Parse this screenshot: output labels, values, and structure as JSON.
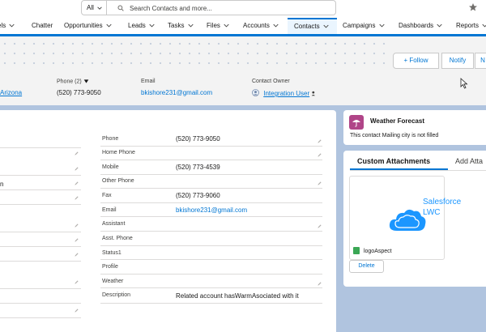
{
  "search": {
    "scope_label": "All",
    "placeholder": "Search Contacts and more..."
  },
  "nav": {
    "items": [
      {
        "label": "els",
        "active": false
      },
      {
        "label": "Chatter",
        "active": false
      },
      {
        "label": "Opportunities",
        "active": false
      },
      {
        "label": "Leads",
        "active": false
      },
      {
        "label": "Tasks",
        "active": false
      },
      {
        "label": "Files",
        "active": false
      },
      {
        "label": "Accounts",
        "active": false
      },
      {
        "label": "Contacts",
        "active": true
      },
      {
        "label": "Campaigns",
        "active": false
      },
      {
        "label": "Dashboards",
        "active": false
      },
      {
        "label": "Reports",
        "active": false
      }
    ]
  },
  "header": {
    "follow_label": "Follow",
    "notify_label": "Notify",
    "more_label": "N",
    "highlights": {
      "account_value": "Arizona",
      "phone_label": "Phone (2)",
      "phone_value": "(520) 773-9050",
      "email_label": "Email",
      "email_value": "bkishore231@gmail.com",
      "owner_label": "Contact Owner",
      "owner_value": "Integration User"
    }
  },
  "details": {
    "left_fragment": "n",
    "fields": [
      {
        "label": "Phone",
        "value": "(520) 773-9050",
        "link": false
      },
      {
        "label": "Home Phone",
        "value": "",
        "link": false
      },
      {
        "label": "Mobile",
        "value": "(520) 773-4539",
        "link": false
      },
      {
        "label": "Other Phone",
        "value": "",
        "link": false
      },
      {
        "label": "Fax",
        "value": "(520) 773-9060",
        "link": false
      },
      {
        "label": "Email",
        "value": "bkishore231@gmail.com",
        "link": true
      },
      {
        "label": "Assistant",
        "value": "",
        "link": false
      },
      {
        "label": "Asst. Phone",
        "value": "",
        "link": false
      },
      {
        "label": "Status1",
        "value": "",
        "link": false
      },
      {
        "label": "Profile",
        "value": "",
        "link": false
      },
      {
        "label": "Weather",
        "value": "",
        "link": false
      },
      {
        "label": "Description",
        "value": "Related account hasWarmAsociated with it",
        "link": false
      }
    ]
  },
  "weather": {
    "title": "Weather Forecast",
    "message": "This contact Mailing city is not filled"
  },
  "attachments": {
    "tab_active": "Custom Attachments",
    "tab_other": "Add Atta",
    "file_name": "logoAspect",
    "logo_text_1": "Salesforce",
    "logo_text_2": "LWC",
    "delete_label": "Delete"
  },
  "colors": {
    "brand": "#0176d3",
    "background": "#b0c4df",
    "weather_icon": "#b04588",
    "file_icon": "#3ba755",
    "cloud": "#1b96ff"
  }
}
